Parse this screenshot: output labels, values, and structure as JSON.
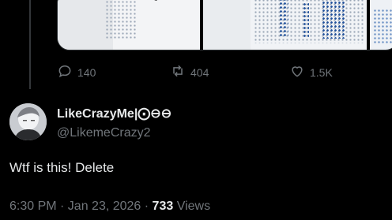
{
  "post": {
    "actions": {
      "replies": "140",
      "reposts": "404",
      "likes": "1.5K"
    }
  },
  "reply": {
    "display_name": "LikeCrazyMe|⨀⊖⊖",
    "handle": "@LikemeCrazy2",
    "text": "Wtf is this! Delete",
    "timestamp": "6:30 PM · Jan 23, 2026",
    "separator": " · ",
    "view_count": "733",
    "views_label": " Views"
  },
  "icons": {
    "reply": "speech-bubble-icon",
    "repost": "repost-arrows-icon",
    "like": "heart-icon"
  },
  "colors": {
    "background": "#000000",
    "text_primary": "#e7e9ea",
    "text_secondary": "#71767b",
    "border": "#2f3336"
  }
}
